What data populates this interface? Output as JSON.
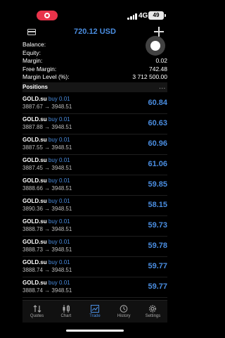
{
  "status_bar": {
    "network": "4G",
    "battery": "49"
  },
  "header": {
    "title": "720.12 USD"
  },
  "summary": [
    {
      "label": "Balance:",
      "value": ""
    },
    {
      "label": "Equity:",
      "value": ""
    },
    {
      "label": "Margin:",
      "value": "0.02"
    },
    {
      "label": "Free Margin:",
      "value": "742.48"
    },
    {
      "label": "Margin Level (%):",
      "value": "3 712 500.00"
    }
  ],
  "positions": {
    "title": "Positions",
    "more": "...",
    "items": [
      {
        "symbol": "GOLD.su",
        "direction": "buy 0.01",
        "prices": "3887.67 → 3948.51",
        "profit": "60.84"
      },
      {
        "symbol": "GOLD.su",
        "direction": "buy 0.01",
        "prices": "3887.88 → 3948.51",
        "profit": "60.63"
      },
      {
        "symbol": "GOLD.su",
        "direction": "buy 0.01",
        "prices": "3887.55 → 3948.51",
        "profit": "60.96"
      },
      {
        "symbol": "GOLD.su",
        "direction": "buy 0.01",
        "prices": "3887.45 → 3948.51",
        "profit": "61.06"
      },
      {
        "symbol": "GOLD.su",
        "direction": "buy 0.01",
        "prices": "3888.66 → 3948.51",
        "profit": "59.85"
      },
      {
        "symbol": "GOLD.su",
        "direction": "buy 0.01",
        "prices": "3890.36 → 3948.51",
        "profit": "58.15"
      },
      {
        "symbol": "GOLD.su",
        "direction": "buy 0.01",
        "prices": "3888.78 → 3948.51",
        "profit": "59.73"
      },
      {
        "symbol": "GOLD.su",
        "direction": "buy 0.01",
        "prices": "3888.73 → 3948.51",
        "profit": "59.78"
      },
      {
        "symbol": "GOLD.su",
        "direction": "buy 0.01",
        "prices": "3888.74 → 3948.51",
        "profit": "59.77"
      },
      {
        "symbol": "GOLD.su",
        "direction": "buy 0.01",
        "prices": "3888.74 → 3948.51",
        "profit": "59.77"
      },
      {
        "symbol": "GOLD.su",
        "direction": "buy 0.01",
        "prices": "",
        "profit": ""
      }
    ]
  },
  "tabs": [
    {
      "label": "Quotes",
      "icon": "quotes-arrows-icon",
      "active": false
    },
    {
      "label": "Chart",
      "icon": "candlestick-chart-icon",
      "active": false
    },
    {
      "label": "Trade",
      "icon": "trade-chart-icon",
      "active": true
    },
    {
      "label": "History",
      "icon": "history-clock-icon",
      "active": false
    },
    {
      "label": "Settings",
      "icon": "gear-icon",
      "active": false
    }
  ],
  "colors": {
    "accent": "#4a8de0",
    "record": "#e8334a",
    "background": "#000000"
  }
}
